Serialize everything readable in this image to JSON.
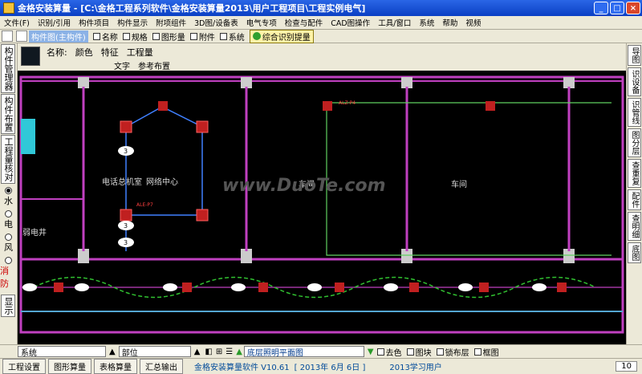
{
  "window": {
    "title": "金格安装算量 - [C:\\金格工程系列软件\\金格安装算量2013\\用户工程项目\\工程实例电气]",
    "controls": {
      "minimize": "_",
      "maximize": "□",
      "close": "×"
    }
  },
  "menu": [
    "文件(F)",
    "识别/引用",
    "构件项目",
    "构件显示",
    "附项组件",
    "3D图/设备表",
    "电气专项",
    "检查与配件",
    "CAD图操作",
    "工具/窗口",
    "系统",
    "帮助",
    "视频"
  ],
  "toolbar": {
    "mode_label": "构件图(主构件)",
    "checkboxes": [
      "名称",
      "规格",
      "图形量",
      "附件",
      "系统"
    ],
    "recognize_label": "综合识别提量"
  },
  "left_tabs": [
    "构件管理器",
    "构件布置",
    "工程量核对"
  ],
  "systems": [
    {
      "label": "水",
      "selected": true
    },
    {
      "label": "电",
      "selected": false
    },
    {
      "label": "风",
      "selected": false
    },
    {
      "label": "消防",
      "selected": false
    }
  ],
  "display_label": "显示",
  "props": {
    "name_label": "名称:",
    "color_label": "颜色",
    "feature_label": "特征",
    "quantity_label": "工程量",
    "tab_text": "文字",
    "tab_reference": "参考布置"
  },
  "right_tabs": [
    "导图",
    "识设备",
    "识管线",
    "图分层",
    "查重复",
    "配件",
    "查明细",
    "底图"
  ],
  "cad": {
    "rooms": [
      "电话总机室",
      "网络中心",
      "弱电井",
      "车间",
      "车间"
    ],
    "nodes": [
      "3",
      "3",
      "3"
    ],
    "labels": [
      "ALZ-P4",
      "ALE-P7"
    ],
    "watermark": "www.DuoTe.com"
  },
  "bottom": {
    "system_combo": "系统",
    "part_combo": "部位",
    "floor": "底层照明平面图",
    "checkboxes": [
      "去色",
      "图块",
      "锁布层",
      "框图"
    ]
  },
  "statusbar": {
    "buttons": [
      "工程设置",
      "图形算量",
      "表格算量",
      "汇总输出"
    ],
    "software": "金格安装算量软件 V10.61",
    "date": "[ 2013年 6月 6日 ]",
    "user": "2013学习用户",
    "page": "10"
  }
}
